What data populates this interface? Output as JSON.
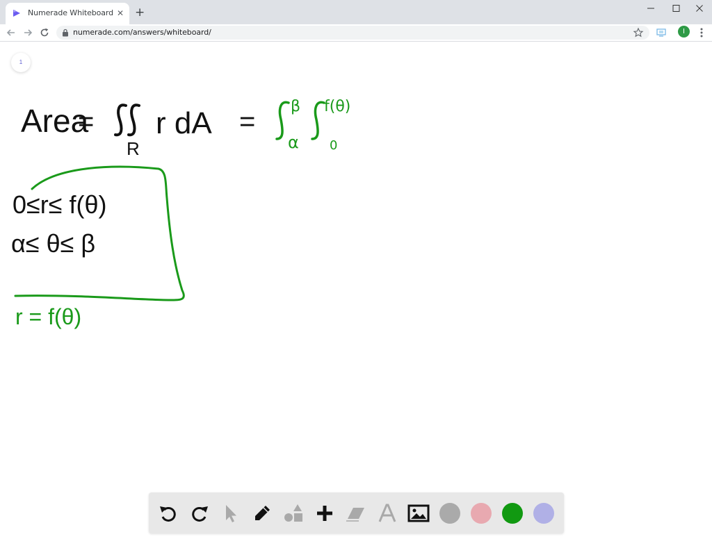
{
  "browser": {
    "tab": {
      "title": "Numerade Whiteboard",
      "close_glyph": "✕"
    },
    "new_tab_glyph": "+",
    "address": {
      "url": "numerade.com/answers/whiteboard/"
    },
    "profile_initial": "I"
  },
  "whiteboard": {
    "page_number": "1",
    "content": {
      "area_formula": {
        "lhs": "Area",
        "equals": "=",
        "integrand": "r dA",
        "region": "R"
      },
      "upper_limit_outer": "β",
      "lower_limit_outer": "α",
      "upper_limit_inner": "f(θ)",
      "lower_limit_inner": "0",
      "ineq_r": "0≤r≤ f(θ)",
      "ineq_theta": "α≤ θ≤ β",
      "curve_label": "r = f(θ)"
    },
    "ink_colors": {
      "black": "#111111",
      "green": "#1a9a1a"
    }
  },
  "toolbar": {
    "tools": [
      {
        "name": "undo-icon"
      },
      {
        "name": "redo-icon"
      },
      {
        "name": "pointer-icon"
      },
      {
        "name": "pen-icon"
      },
      {
        "name": "shapes-icon"
      },
      {
        "name": "plus-icon"
      },
      {
        "name": "eraser-icon"
      },
      {
        "name": "text-icon"
      },
      {
        "name": "image-icon"
      }
    ],
    "colors": [
      "#aaaaaa",
      "#e8a9b0",
      "#119911",
      "#b0b0e6"
    ]
  }
}
